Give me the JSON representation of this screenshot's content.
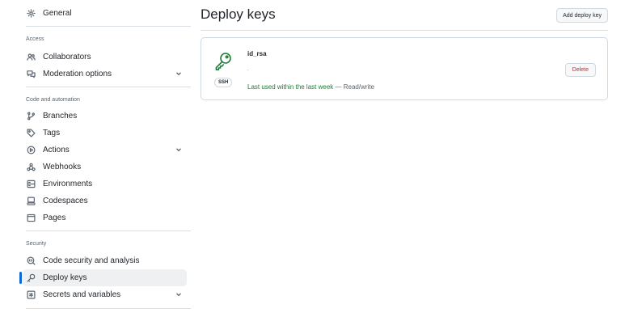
{
  "sidebar": {
    "general": {
      "label": "General",
      "icon": "gear-icon"
    },
    "access_heading": "Access",
    "access": [
      {
        "label": "Collaborators",
        "icon": "people-icon"
      },
      {
        "label": "Moderation options",
        "icon": "comment-discussion-icon",
        "expandable": true
      }
    ],
    "code_heading": "Code and automation",
    "code": [
      {
        "label": "Branches",
        "icon": "git-branch-icon"
      },
      {
        "label": "Tags",
        "icon": "tag-icon"
      },
      {
        "label": "Actions",
        "icon": "play-icon",
        "expandable": true
      },
      {
        "label": "Webhooks",
        "icon": "webhook-icon"
      },
      {
        "label": "Environments",
        "icon": "server-icon"
      },
      {
        "label": "Codespaces",
        "icon": "codespaces-icon"
      },
      {
        "label": "Pages",
        "icon": "browser-icon"
      }
    ],
    "security_heading": "Security",
    "security": [
      {
        "label": "Code security and analysis",
        "icon": "codescan-icon"
      },
      {
        "label": "Deploy keys",
        "icon": "key-icon",
        "active": true
      },
      {
        "label": "Secrets and variables",
        "icon": "asterisk-icon",
        "expandable": true
      }
    ]
  },
  "main": {
    "title": "Deploy keys",
    "add_button": "Add deploy key",
    "key": {
      "title": "id_rsa",
      "badge": "SSH",
      "fingerprint": ".",
      "last_used": "Last used within the last week",
      "separator": " — ",
      "access": "Read/write",
      "delete_button": "Delete"
    }
  },
  "colors": {
    "accent": "#0969da",
    "success": "#1a7f37",
    "danger": "#d1242f",
    "border": "#d1d9e0"
  }
}
